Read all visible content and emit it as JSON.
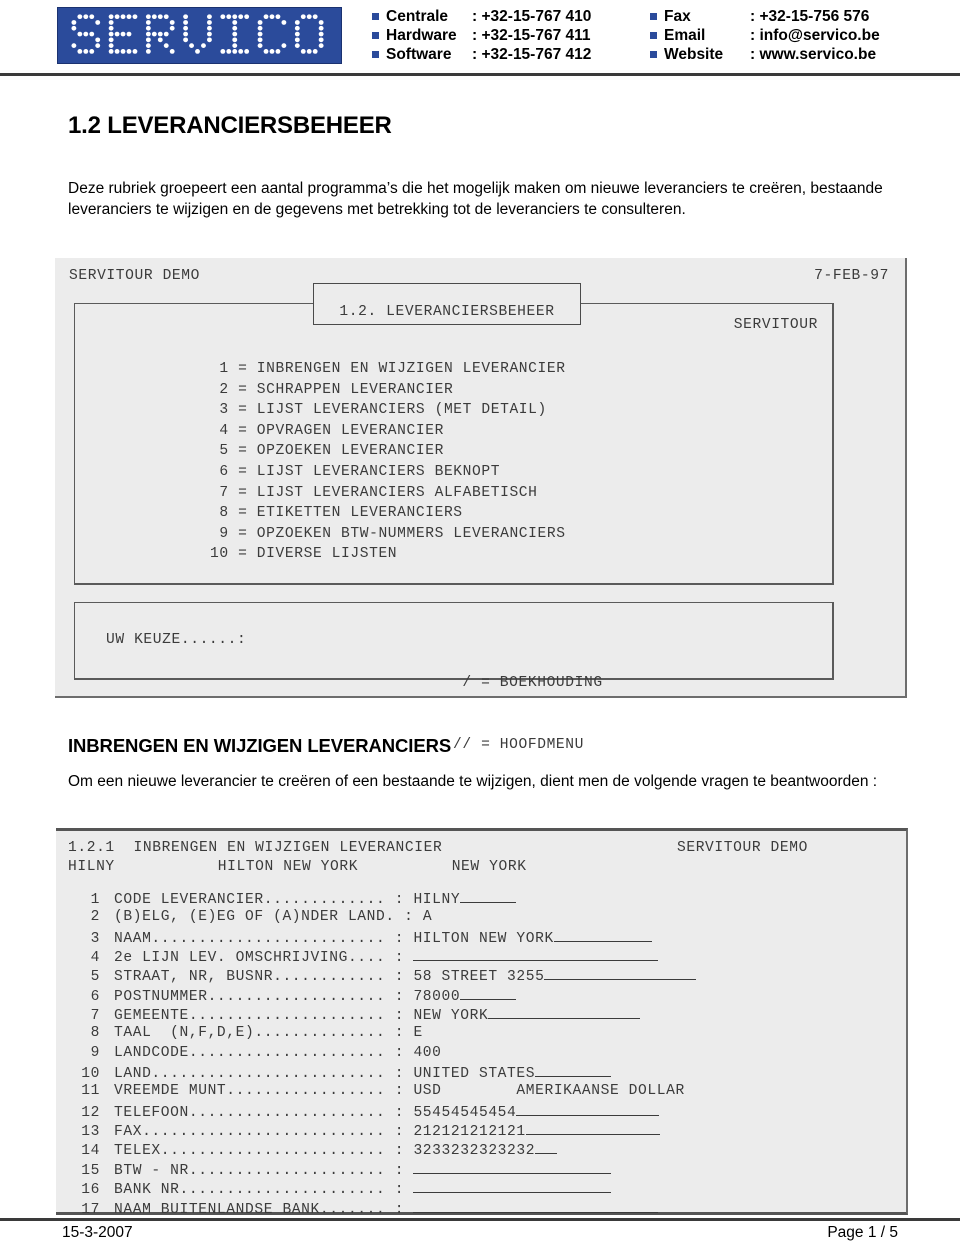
{
  "letterhead": {
    "logo_text": "SERVICO",
    "brand_color": "#2B4B9B",
    "contacts_left": [
      {
        "label": "Centrale",
        "sep": ":",
        "value": "+32-15-767 410"
      },
      {
        "label": "Hardware",
        "sep": ":",
        "value": "+32-15-767 411"
      },
      {
        "label": "Software",
        "sep": ":",
        "value": "+32-15-767 412"
      }
    ],
    "contacts_right": [
      {
        "label": "Fax",
        "sep": ":",
        "value": "+32-15-756 576"
      },
      {
        "label": "Email",
        "sep": ":",
        "value": "info@servico.be"
      },
      {
        "label": "Website",
        "sep": ":",
        "value": "www.servico.be"
      }
    ]
  },
  "section1": {
    "title": "1.2 LEVERANCIERSBEHEER",
    "intro": "Deze rubriek groepeert een aantal programma’s die het mogelijk maken om nieuwe leveranciers te creëren, bestaande leveranciers te wijzigen en de gegevens met betrekking tot de leveranciers te consulteren."
  },
  "terminal1": {
    "app_name": "SERVITOUR DEMO",
    "date": "7-FEB-97",
    "menu_box_title": "1.2. LEVERANCIERSBEHEER",
    "panel_label": "SERVITOUR",
    "menu_items": [
      {
        "num": " 1",
        "eq": "=",
        "label": "INBRENGEN EN WIJZIGEN LEVERANCIER"
      },
      {
        "num": " 2",
        "eq": "=",
        "label": "SCHRAPPEN LEVERANCIER"
      },
      {
        "num": " 3",
        "eq": "=",
        "label": "LIJST LEVERANCIERS (MET DETAIL)"
      },
      {
        "num": " 4",
        "eq": "=",
        "label": "OPVRAGEN LEVERANCIER"
      },
      {
        "num": " 5",
        "eq": "=",
        "label": "OPZOEKEN LEVERANCIER"
      },
      {
        "num": " 6",
        "eq": "=",
        "label": "LIJST LEVERANCIERS BEKNOPT"
      },
      {
        "num": " 7",
        "eq": "=",
        "label": "LIJST LEVERANCIERS ALFABETISCH"
      },
      {
        "num": " 8",
        "eq": "=",
        "label": "ETIKETTEN LEVERANCIERS"
      },
      {
        "num": " 9",
        "eq": "=",
        "label": "OPZOEKEN BTW-NUMMERS LEVERANCIERS"
      },
      {
        "num": "10",
        "eq": "=",
        "label": "DIVERSE LIJSTEN"
      }
    ],
    "prompt": "UW KEUZE......:",
    "shortcut_1": " / = BOEKHOUDING",
    "shortcut_2": "// = HOOFDMENU"
  },
  "section2": {
    "title": "INBRENGEN EN WIJZIGEN LEVERANCIERS",
    "intro": "Om een nieuwe leverancier te creëren of een bestaande te wijzigen, dient men de volgende vragen te beantwoorden :"
  },
  "terminal2": {
    "screen_code": "1.2.1",
    "screen_title": "INBRENGEN EN WIJZIGEN LEVERANCIER",
    "app_name": "SERVITOUR DEMO",
    "record_code": "HILNY",
    "record_name": "HILTON NEW YORK",
    "record_city": "NEW YORK",
    "fields": [
      {
        "num": "1",
        "label": "CODE LEVERANCIER.............",
        "colon": ":",
        "value": "HILNY",
        "blank": 56,
        "extra": ""
      },
      {
        "num": "2",
        "label": "(B)ELG, (E)EG OF (A)NDER LAND.",
        "colon": ":",
        "value": "A",
        "blank": 0,
        "extra": ""
      },
      {
        "num": "3",
        "label": "NAAM.........................",
        "colon": ":",
        "value": "HILTON NEW YORK",
        "blank": 98,
        "extra": ""
      },
      {
        "num": "4",
        "label": "2e LIJN LEV. OMSCHRIJVING....",
        "colon": ":",
        "value": "",
        "blank": 245,
        "extra": ""
      },
      {
        "num": "5",
        "label": "STRAAT, NR, BUSNR............",
        "colon": ":",
        "value": "58 STREET 3255",
        "blank": 152,
        "extra": ""
      },
      {
        "num": "6",
        "label": "POSTNUMMER...................",
        "colon": ":",
        "value": "78000",
        "blank": 56,
        "extra": ""
      },
      {
        "num": "7",
        "label": "GEMEENTE.....................",
        "colon": ":",
        "value": "NEW YORK",
        "blank": 152,
        "extra": ""
      },
      {
        "num": "8",
        "label": "TAAL  (N,F,D,E)..............",
        "colon": ":",
        "value": "E",
        "blank": 0,
        "extra": ""
      },
      {
        "num": "9",
        "label": "LANDCODE.....................",
        "colon": ":",
        "value": "400",
        "blank": 0,
        "extra": ""
      },
      {
        "num": "10",
        "label": "LAND.........................",
        "colon": ":",
        "value": "UNITED STATES",
        "blank": 76,
        "extra": ""
      },
      {
        "num": "11",
        "label": "VREEMDE MUNT.................",
        "colon": ":",
        "value": "USD",
        "blank": 0,
        "extra": "AMERIKAANSE DOLLAR"
      },
      {
        "num": "12",
        "label": "TELEFOON.....................",
        "colon": ":",
        "value": "55454545454",
        "blank": 143,
        "extra": ""
      },
      {
        "num": "13",
        "label": "FAX..........................",
        "colon": ":",
        "value": "212121212121",
        "blank": 134,
        "extra": ""
      },
      {
        "num": "14",
        "label": "TELEX........................",
        "colon": ":",
        "value": "3233232323232",
        "blank": 22,
        "extra": ""
      },
      {
        "num": "15",
        "label": "BTW - NR.....................",
        "colon": ":",
        "value": "",
        "blank": 198,
        "extra": ""
      },
      {
        "num": "16",
        "label": "BANK NR......................",
        "colon": ":",
        "value": "",
        "blank": 198,
        "extra": ""
      },
      {
        "num": "17",
        "label": "NAAM BUITENLANDSE BANK.......",
        "colon": ":",
        "value": "",
        "blank": 245,
        "extra": ""
      }
    ]
  },
  "footer": {
    "date": "15-3-2007",
    "page": "Page 1 / 5"
  }
}
